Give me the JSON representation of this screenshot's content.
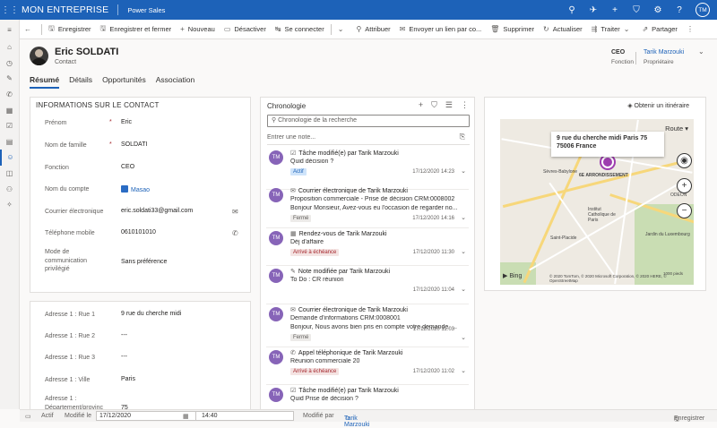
{
  "topbar": {
    "brand": "MON ENTREPRISE",
    "app": "Power Sales",
    "user_initials": "TM"
  },
  "commands": [
    {
      "icon": "save-icon",
      "glyph": "🖫",
      "label": "Enregistrer"
    },
    {
      "icon": "save-close-icon",
      "glyph": "🖫",
      "label": "Enregistrer et fermer"
    },
    {
      "icon": "plus-icon",
      "glyph": "+",
      "label": "Nouveau"
    },
    {
      "icon": "deactivate-icon",
      "glyph": "▭",
      "label": "Désactiver"
    },
    {
      "icon": "connect-icon",
      "glyph": "↹",
      "label": "Se connecter"
    },
    {
      "icon": "assign-icon",
      "glyph": "⚲",
      "label": "Attribuer"
    },
    {
      "icon": "email-link-icon",
      "glyph": "✉",
      "label": "Envoyer un lien par co..."
    },
    {
      "icon": "delete-icon",
      "glyph": "🗑",
      "label": "Supprimer"
    },
    {
      "icon": "refresh-icon",
      "glyph": "↻",
      "label": "Actualiser"
    },
    {
      "icon": "flow-icon",
      "glyph": "⇶",
      "label": "Traiter"
    },
    {
      "icon": "share-icon",
      "glyph": "⇗",
      "label": "Partager"
    }
  ],
  "record": {
    "name": "Eric SOLDATI",
    "type": "Contact",
    "job_title": "CEO",
    "job_title_label": "Fonction",
    "owner": "Tarik Marzouki",
    "owner_label": "Propriétaire"
  },
  "tabs": [
    "Résumé",
    "Détails",
    "Opportunités",
    "Association"
  ],
  "contact_info": {
    "title": "INFORMATIONS SUR LE CONTACT",
    "fields": [
      {
        "label": "Prénom",
        "value": "Eric",
        "required": "*"
      },
      {
        "label": "Nom de famille",
        "value": "SOLDATI",
        "required": "*"
      },
      {
        "label": "Fonction",
        "value": "CEO",
        "required": ""
      },
      {
        "label": "Nom du compte",
        "value": "Masao",
        "required": ""
      },
      {
        "label": "Courrier électronique",
        "value": "eric.soldati33@gmail.com",
        "required": ""
      },
      {
        "label": "Téléphone mobile",
        "value": "0610101010",
        "required": ""
      },
      {
        "label": "Mode de communication privilégié",
        "value": "Sans préférence",
        "required": ""
      }
    ]
  },
  "address": {
    "fields": [
      {
        "label": "Adresse 1 : Rue 1",
        "value": "9 rue du cherche midi"
      },
      {
        "label": "Adresse 1 : Rue 2",
        "value": "---"
      },
      {
        "label": "Adresse 1 : Rue 3",
        "value": "---"
      },
      {
        "label": "Adresse 1 : Ville",
        "value": "Paris"
      },
      {
        "label": "Adresse 1 : Département/provinc",
        "value": "75"
      }
    ]
  },
  "timeline": {
    "title": "Chronologie",
    "search_placeholder": "Chronologie de la recherche",
    "note_placeholder": "Entrer une note...",
    "items": [
      {
        "initials": "TM",
        "glyph": "☑",
        "head": "Tâche modifié(e) par Tarik Marzouki",
        "line2": "Quid décision ?",
        "line3": "",
        "badge": "Actif",
        "badge_class": "b-actif",
        "date": "17/12/2020 14:23"
      },
      {
        "initials": "TM",
        "glyph": "✉",
        "head": "Courrier électronique de Tarik Marzouki",
        "line2": "Proposition commerciale - Prise de décision CRM:0008002",
        "line3": "Bonjour Monsieur,   Avez-vous eu l'occasion de regarder no...",
        "badge": "Fermé",
        "badge_class": "b-ferme",
        "date": "17/12/2020 14:16"
      },
      {
        "initials": "TM",
        "glyph": "▦",
        "head": "Rendez-vous de Tarik Marzouki",
        "line2": "Déj d'affaire",
        "line3": "",
        "badge": "Arrivé à échéance",
        "badge_class": "b-arrive",
        "date": "17/12/2020 11:30"
      },
      {
        "initials": "TM",
        "glyph": "✎",
        "head": "Note modifiée par Tarik Marzouki",
        "line2": "To Do : CR réunion",
        "line3": "",
        "badge": "",
        "badge_class": "",
        "date": "17/12/2020 11:04"
      },
      {
        "initials": "TM",
        "glyph": "✉",
        "head": "Courrier électronique de Tarik Marzouki",
        "line2": "Demande d'informations CRM:0008001",
        "line3": "Bonjour,   Nous avons bien pris en compte votre demande. ...",
        "badge": "Fermé",
        "badge_class": "b-ferme",
        "date": "17/12/2020 11:03"
      },
      {
        "initials": "TM",
        "glyph": "✆",
        "head": "Appel téléphonique de Tarik Marzouki",
        "line2": "Réunion commerciale 20",
        "line3": "",
        "badge": "Arrivé à échéance",
        "badge_class": "b-arrive",
        "date": "17/12/2020 11:02"
      },
      {
        "initials": "TM",
        "glyph": "☑",
        "head": "Tâche modifié(e) par Tarik Marzouki",
        "line2": "Quid Prise de décision ?",
        "line3": "",
        "badge": "",
        "badge_class": "",
        "date": ""
      }
    ]
  },
  "map": {
    "directions": "Obtenir un itinéraire",
    "address_line1": "9 rue du cherche midi Paris 75",
    "address_line2": "75006 France",
    "route_label": "Route",
    "provider": "Bing",
    "copyright": "© 2020 TomTom, © 2020 Microsoft Corporation, © 2020 HERE, © OpenStreetMap",
    "scale": "1000 pieds",
    "labels": [
      "6E ARRONDISSEMENT",
      "ODEON",
      "Jardin du Luxembourg",
      "Institut Catholique de Paris",
      "Sèvres-Babylone",
      "Saint-Placide"
    ]
  },
  "status": {
    "state": "Actif",
    "modified_on_label": "Modifié le",
    "date": "17/12/2020",
    "time": "14:40",
    "modified_by_label": "Modifié par",
    "modified_by": "Tarik Marzouki",
    "save": "Enregistrer"
  }
}
